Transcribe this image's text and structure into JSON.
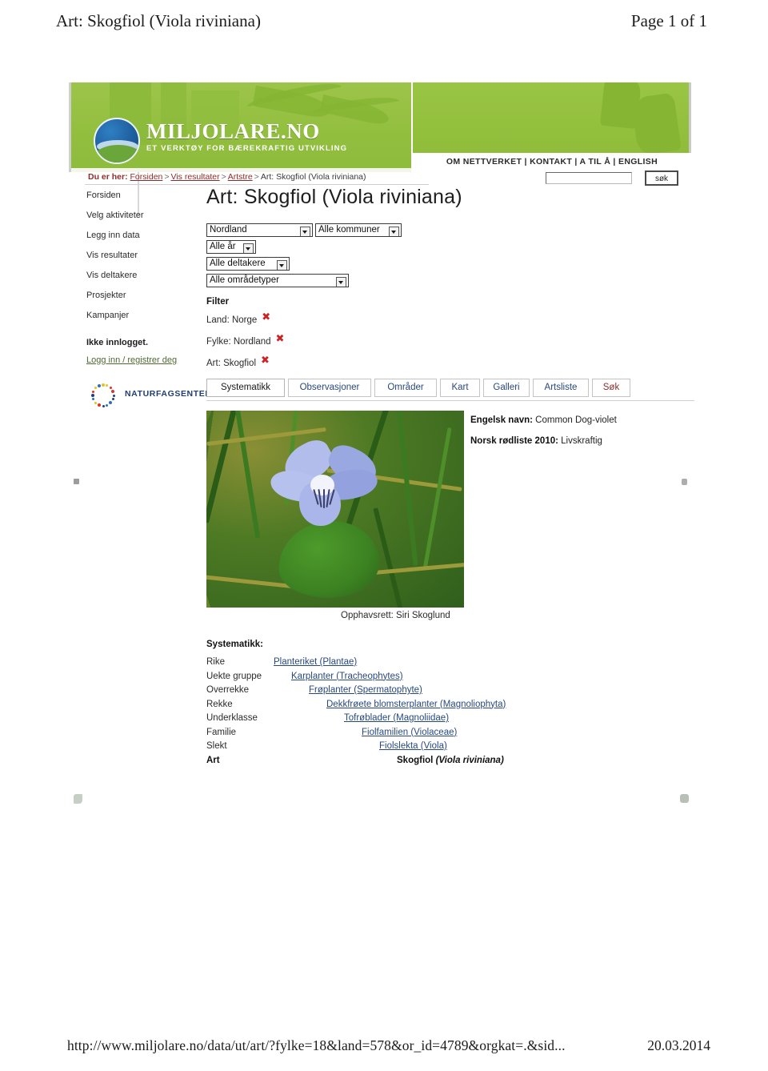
{
  "page": {
    "header_title": "Art: Skogfiol (Viola riviniana)",
    "header_page": "Page 1 of 1",
    "footer_url": "http://www.miljolare.no/data/ut/art/?fylke=18&land=578&or_id=4789&orgkat=.&sid...",
    "footer_date": "20.03.2014"
  },
  "banner": {
    "logo_main": "MILJOLARE.NO",
    "logo_sub": "ET VERKTØY FOR BÆREKRAFTIG UTVIKLING"
  },
  "topnav": {
    "links_line": "OM NETTVERKET | KONTAKT | A TIL Å | ENGLISH",
    "items": [
      "OM NETTVERKET",
      "KONTAKT",
      "A TIL Å",
      "ENGLISH"
    ],
    "search_value": "",
    "search_placeholder": "",
    "search_button": "søk"
  },
  "breadcrumb": {
    "label": "Du er her:",
    "items": [
      "Forsiden",
      "Vis resultater",
      "Artstre"
    ],
    "current": "Art: Skogfiol (Viola riviniana)",
    "separator": ">"
  },
  "sidebar": {
    "items": [
      "Forsiden",
      "Velg aktiviteter",
      "Legg inn data",
      "Vis resultater",
      "Vis deltakere",
      "Prosjekter",
      "Kampanjer"
    ],
    "status": "Ikke innlogget.",
    "login_link": "Logg inn / registrer deg",
    "partner_logo": "NATURFAGSENTERET"
  },
  "main": {
    "title": "Art: Skogfiol (Viola riviniana)",
    "selects": [
      {
        "name": "fylke",
        "value": "Nordland"
      },
      {
        "name": "kommune",
        "value": "Alle kommuner"
      },
      {
        "name": "ar",
        "value": "Alle år"
      },
      {
        "name": "deltakere",
        "value": "Alle deltakere"
      },
      {
        "name": "omradetype",
        "value": "Alle områdetyper"
      }
    ],
    "filter_heading": "Filter",
    "filters": [
      {
        "label": "Land: Norge",
        "remove": "✖"
      },
      {
        "label": "Fylke: Nordland",
        "remove": "✖"
      },
      {
        "label": "Art: Skogfiol",
        "remove": "✖"
      }
    ],
    "tabs": [
      {
        "label": "Systematikk",
        "active": true
      },
      {
        "label": "Observasjoner",
        "active": false
      },
      {
        "label": "Områder",
        "active": false
      },
      {
        "label": "Kart",
        "active": false
      },
      {
        "label": "Galleri",
        "active": false
      },
      {
        "label": "Artsliste",
        "active": false
      },
      {
        "label": "Søk",
        "active": false
      }
    ],
    "photo_copyright": "Opphavsrett: Siri Skoglund",
    "info": {
      "english_label": "Engelsk navn:",
      "english_value": "Common Dog-violet",
      "redlist_label": "Norsk rødliste 2010:",
      "redlist_value": "Livskraftig"
    },
    "systematikk_heading": "Systematikk:",
    "systematikk": [
      {
        "rank": "Rike",
        "taxon": "Planteriket (Plantae)",
        "indent": 0
      },
      {
        "rank": "Uekte gruppe",
        "taxon": "Karplanter (Tracheophytes)",
        "indent": 1
      },
      {
        "rank": "Overrekke",
        "taxon": "Frøplanter (Spermatophyte)",
        "indent": 2
      },
      {
        "rank": "Rekke",
        "taxon": "Dekkfrøete blomsterplanter (Magnoliophyta)",
        "indent": 3
      },
      {
        "rank": "Underklasse",
        "taxon": "Tofrøblader (Magnoliidae)",
        "indent": 4
      },
      {
        "rank": "Familie",
        "taxon": "Fiolfamilien (Violaceae)",
        "indent": 5
      },
      {
        "rank": "Slekt",
        "taxon": "Fiolslekta (Viola)",
        "indent": 6
      },
      {
        "rank": "Art",
        "taxon": "Skogfiol (Viola riviniana)",
        "indent": 7,
        "last": true
      }
    ]
  },
  "colors": {
    "banner_green": "#93bf3f",
    "link_blue": "#27487e",
    "breadcrumb_red": "#8c2d2d",
    "remove_red": "#cc2222",
    "partner_blue": "#1f3f73"
  }
}
